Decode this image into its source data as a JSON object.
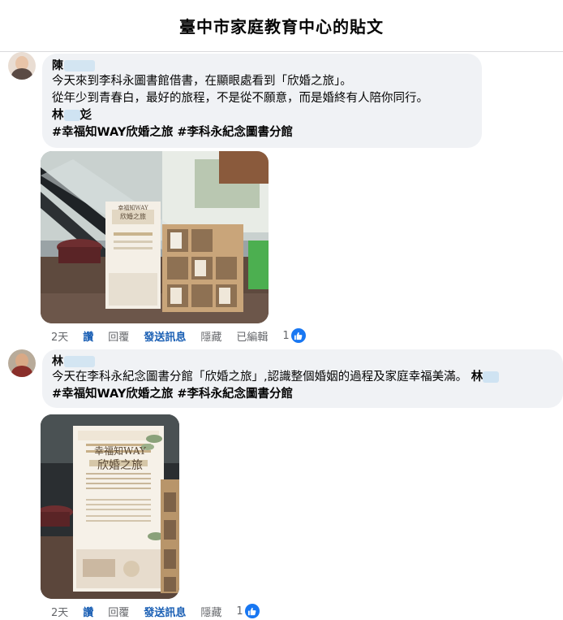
{
  "page": {
    "title": "臺中市家庭教育中心的貼文"
  },
  "colors": {
    "link": "#1a5fb4",
    "bubble_bg": "#f0f2f5",
    "like_blue": "#1877f2",
    "meta_gray": "#65676b"
  },
  "comments": [
    {
      "author": "陳",
      "lines": [
        "今天來到李科永圖書館借書，在顯眼處看到「欣婚之旅」。",
        "從年少到青春白，最好的旅程，不是從不願意，而是婚終有人陪你同行。"
      ],
      "signature": "林",
      "signature_tail": "彣",
      "hashtags": "#幸福知WAY欣婚之旅 #李科永紀念圖書分館",
      "actions": {
        "time": "2天",
        "like": "讚",
        "reply": "回覆",
        "message": "發送訊息",
        "hide": "隱藏",
        "edited": "已編輯",
        "reaction_count": "1"
      },
      "photo_icon": "display-shelf-photo"
    },
    {
      "author": "林",
      "lines": [
        "今天在李科永紀念圖書分館「欣婚之旅」,認識整個婚姻的過程及家庭幸福美滿。"
      ],
      "signature": "林",
      "signature_tail": "",
      "hashtags": "#幸福知WAY欣婚之旅 #李科永紀念圖書分館",
      "actions": {
        "time": "2天",
        "like": "讚",
        "reply": "回覆",
        "message": "發送訊息",
        "hide": "隱藏",
        "reaction_count": "1"
      },
      "photo_icon": "poster-banner-photo"
    }
  ],
  "poster": {
    "small_heading": "幸福知WAY",
    "small_title": "欣婚之旅",
    "big_heading": "幸福知WAY",
    "big_title": "欣婚之旅"
  }
}
